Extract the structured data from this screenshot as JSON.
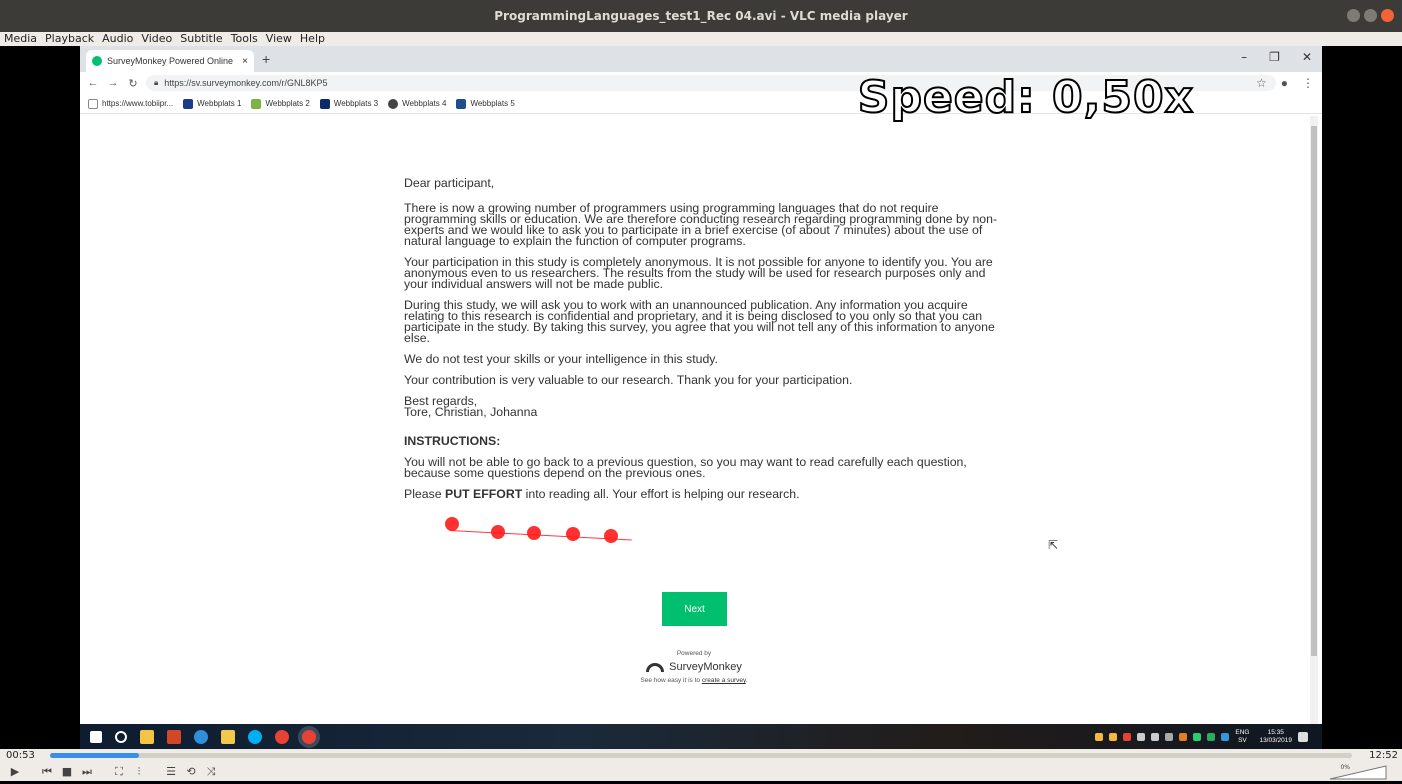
{
  "vlc": {
    "title": "ProgrammingLanguages_test1_Rec 04.avi - VLC media player",
    "menu": [
      "Media",
      "Playback",
      "Audio",
      "Video",
      "Subtitle",
      "Tools",
      "View",
      "Help"
    ],
    "time_elapsed": "00:53",
    "time_total": "12:52",
    "progress": 0.068,
    "volume_label": "0%"
  },
  "browser": {
    "tab_title": "SurveyMonkey Powered Online |",
    "tab_close": "×",
    "new_tab": "+",
    "url": "https://sv.surveymonkey.com/r/GNL8KP5",
    "bookmarks": [
      "https://www.tobiipr...",
      "Webbplats 1",
      "Webbplats 2",
      "Webbplats 3",
      "Webbplats 4",
      "Webbplats 5"
    ]
  },
  "overlay": {
    "speed": "Speed: 0,50x"
  },
  "survey": {
    "greeting": "Dear participant,",
    "paragraphs": [
      "There is now a growing number of programmers using programming languages that do not require programming skills or education. We are therefore conducting research regarding programming done by non-experts and we would like to ask you to participate in a brief exercise (of about 7 minutes) about the use of natural language to explain the function of computer programs.",
      "Your participation in this study is completely anonymous. It is not possible for anyone to identify you. You are anonymous even to us researchers. The results from the study will be used for research purposes only and your individual answers will not be made public.",
      "During this study, we will ask you to work with an unannounced publication. Any information you acquire relating to this research is confidential and proprietary, and it is being disclosed to you only so that you can participate in the study. By taking this survey, you agree that you will not tell any of this information to anyone else.",
      "We do not test your skills or your intelligence in this study.",
      "Your contribution is very valuable to our research. Thank you for your participation."
    ],
    "regards": "Best regards,",
    "names": "Tore, Christian, Johanna",
    "instructions_title": "INSTRUCTIONS:",
    "instructions_text": "You will not be able to go back to a previous question, so you may want to read carefully each question, because some questions depend on the previous ones.",
    "please": "Please",
    "put_effort": "PUT EFFORT",
    "effort_rest": "into reading all. Your effort is helping our research.",
    "next": "Next",
    "powered_by": "Powered by",
    "brand": "SurveyMonkey",
    "see_how": "See how easy it is to",
    "create_link": "create a survey",
    "period": "."
  },
  "taskbar": {
    "lang": "ENG",
    "lang2": "SV",
    "time": "15:35",
    "date": "13/03/2019"
  }
}
